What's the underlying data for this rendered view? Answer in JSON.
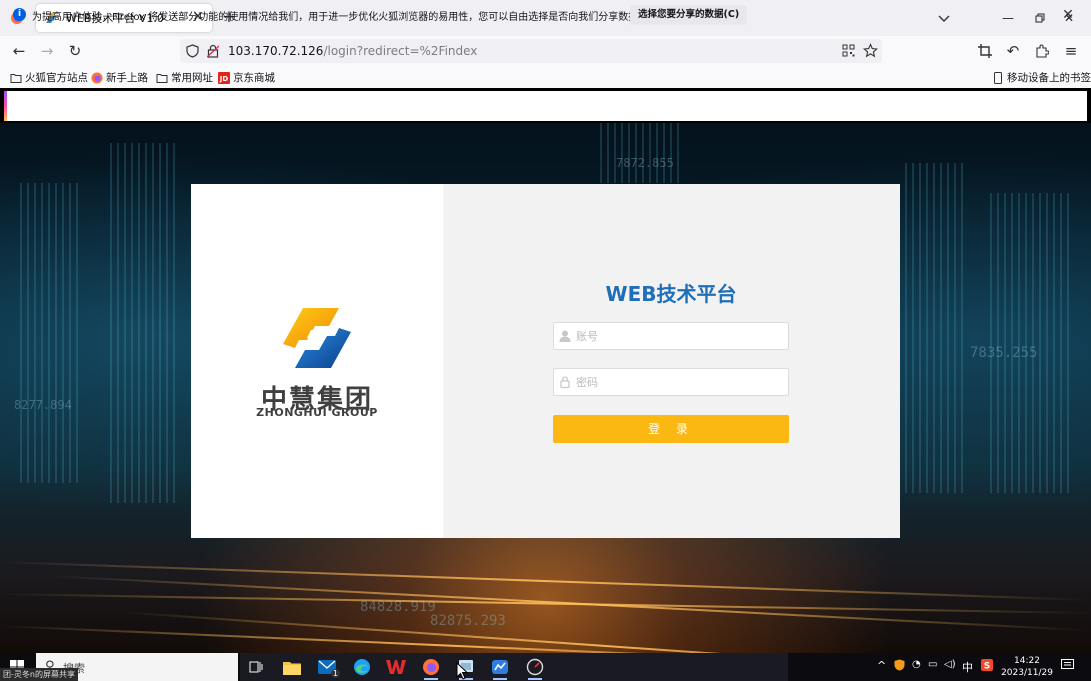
{
  "browser": {
    "tab_title": "WEB技术平台 V1.0",
    "url_host": "103.170.72.126",
    "url_path": "/login?redirect=%2Findex"
  },
  "bookmarks": {
    "items": [
      {
        "label": "火狐官方站点",
        "icon": "folder-icon"
      },
      {
        "label": "新手上路",
        "icon": "firefox-icon"
      },
      {
        "label": "常用网址",
        "icon": "folder-icon"
      },
      {
        "label": "京东商城",
        "icon": "jd-icon"
      }
    ],
    "mobile": "移动设备上的书签"
  },
  "notice": {
    "text": "为提高用户体验，Firefox 将发送部分功能的使用情况给我们，用于进一步优化火狐浏览器的易用性，您可以自由选择是否向我们分享数据。",
    "button": "选择您要分享的数据(C)"
  },
  "login": {
    "company_cn": "中慧集团",
    "company_en": "ZHONGHUI GROUP",
    "title": "WEB技术平台",
    "username_placeholder": "账号",
    "password_placeholder": "密码",
    "submit": "登 录",
    "accent_color": "#fbb813",
    "title_color": "#1f6fb8"
  },
  "background_numbers": [
    "7872.855",
    "8277.894",
    "84828.919",
    "82875.293",
    "7835.255"
  ],
  "taskbar": {
    "search_placeholder": "搜索",
    "share_tip": "团-灵冬n的屏幕共享",
    "ime": "中",
    "time": "14:22",
    "date": "2023/11/29",
    "mail_badge": "1"
  }
}
